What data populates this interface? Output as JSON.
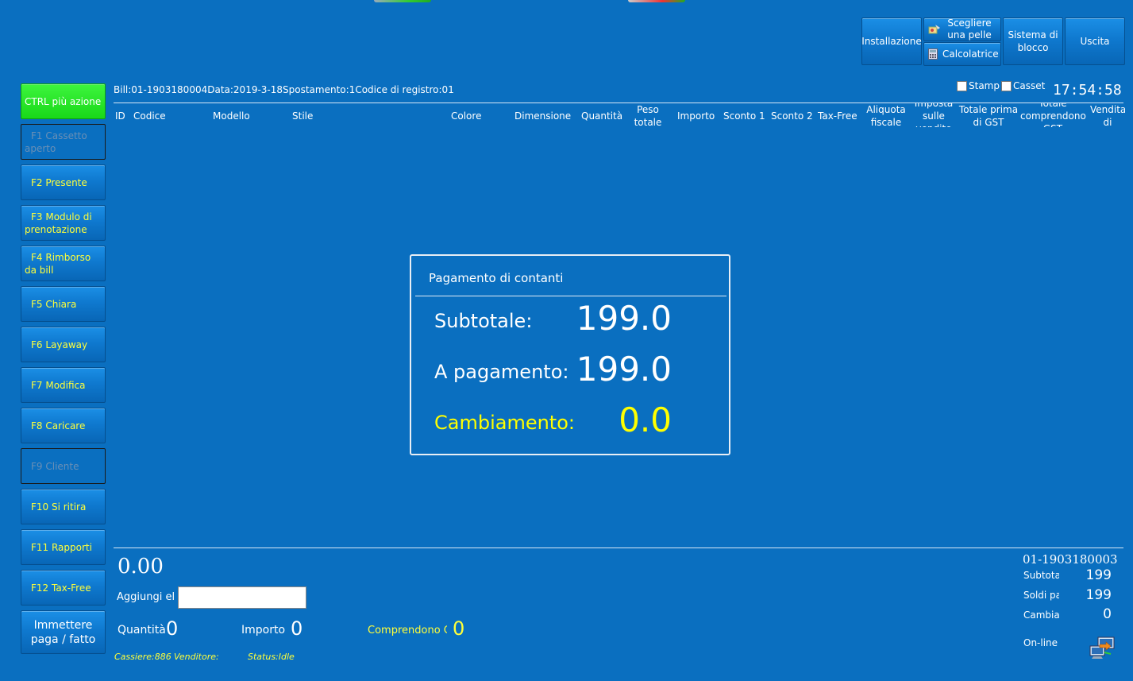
{
  "top_buttons": {
    "installazione": "Installazione",
    "scegliere_pelle": "Scegliere una pelle",
    "calcolatrice": "Calcolatrice",
    "sistema_blocco": "Sistema di blocco",
    "uscita": "Uscita"
  },
  "bill_info": "Bill:01-1903180004Data:2019-3-18Spostamento:1Codice di registro:01",
  "checkboxes": {
    "stamp": "Stamp",
    "casset": "Casset"
  },
  "clock": "17:54:58",
  "columns": [
    "ID",
    "Codice",
    "Modello",
    "Stile",
    "Colore",
    "Dimensione",
    "Quantità",
    "Peso totale",
    "Importo",
    "Sconto 1",
    "Sconto 2",
    "Tax-Free",
    "Aliquota fiscale",
    "Imposta sulle vendite",
    "Totale prima di GST",
    "Totale comprendono GST",
    "Vendita di"
  ],
  "sidebar": [
    {
      "label": "CTRL più azione",
      "state": "green"
    },
    {
      "label": "F1 Cassetto aperto",
      "state": "disabled"
    },
    {
      "label": "F2 Presente",
      "state": "normal"
    },
    {
      "label": "F3 Modulo di prenotazione",
      "state": "normal"
    },
    {
      "label": "F4 Rimborso da bill",
      "state": "normal"
    },
    {
      "label": "F5 Chiara",
      "state": "normal"
    },
    {
      "label": "F6 Layaway",
      "state": "normal"
    },
    {
      "label": "F7 Modifica",
      "state": "normal"
    },
    {
      "label": "F8 Caricare",
      "state": "normal"
    },
    {
      "label": "F9 Cliente",
      "state": "disabled"
    },
    {
      "label": "F10 Si ritira",
      "state": "normal"
    },
    {
      "label": "F11 Rapporti",
      "state": "normal"
    },
    {
      "label": "F12 Tax-Free",
      "state": "normal"
    },
    {
      "label": "Immettere paga / fatto",
      "state": "big"
    }
  ],
  "modal": {
    "title": "Pagamento di contanti",
    "subtotale_label": "Subtotale:",
    "subtotale_value": "199.0",
    "pagamento_label": "A pagamento:",
    "pagamento_value": "199.0",
    "cambiamento_label": "Cambiamento:",
    "cambiamento_value": "0.0"
  },
  "bottom": {
    "total": "0.00",
    "aggiungi_label": "Aggiungi elemento",
    "aggiungi_value": "",
    "quantita_label": "Quantità",
    "quantita_value": "0",
    "importo_label": "Importo",
    "importo_value": "0",
    "comprendono_label": "Comprendono GST",
    "comprendono_value": "0",
    "cassiere": "Cassiere:886",
    "venditore": "Venditore:",
    "status": "Status:Idle"
  },
  "last_bill": {
    "number": "01-1903180003",
    "subtotale_label": "Subtotale",
    "subtotale_value": "199",
    "soldi_label": "Soldi pagati",
    "soldi_value": "199",
    "cambia_label": "Cambiamento",
    "cambia_value": "0",
    "online_label": "On-line"
  },
  "colors": {
    "background": "#0a6fc0",
    "accent_yellow": "#ffff00",
    "green": "#33e633"
  }
}
